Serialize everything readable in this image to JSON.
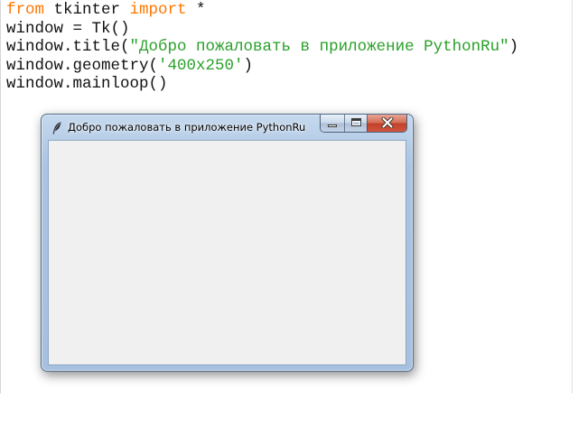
{
  "editor": {
    "lines": [
      [
        {
          "t": "from",
          "c": "kw"
        },
        {
          "t": " tkinter ",
          "c": "plain"
        },
        {
          "t": "import",
          "c": "kw"
        },
        {
          "t": " *",
          "c": "plain"
        }
      ],
      [
        {
          "t": "window = Tk()",
          "c": "plain"
        }
      ],
      [
        {
          "t": "window.title(",
          "c": "plain"
        },
        {
          "t": "\"Добро пожаловать в приложение PythonRu\"",
          "c": "str"
        },
        {
          "t": ")",
          "c": "plain"
        }
      ],
      [
        {
          "t": "window.geometry(",
          "c": "plain"
        },
        {
          "t": "'400x250'",
          "c": "str"
        },
        {
          "t": ")",
          "c": "plain"
        }
      ],
      [
        {
          "t": "window.mainloop()",
          "c": "plain"
        }
      ]
    ],
    "colors": {
      "keyword": "#ff7700",
      "string": "#2aa02a",
      "text": "#111111"
    }
  },
  "tk_window": {
    "title": "Добро пожаловать в приложение PythonRu",
    "app_icon": "feather-icon",
    "controls": {
      "minimize_icon": "minimize-icon",
      "maximize_icon": "maximize-icon",
      "close_icon": "close-icon"
    },
    "client_background": "#f0f0f0",
    "frame_color": "#a9c3e1"
  }
}
